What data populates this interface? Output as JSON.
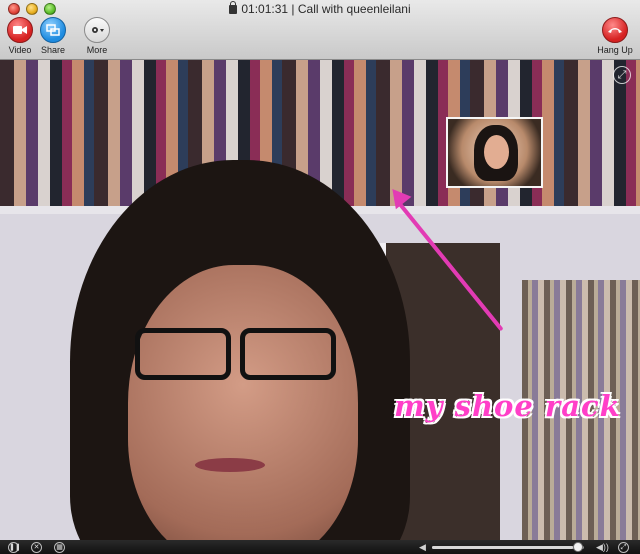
{
  "window": {
    "title": "01:01:31 | Call with queenleilani"
  },
  "toolbar": {
    "video_label": "Video",
    "share_label": "Share",
    "more_label": "More",
    "hangup_label": "Hang Up"
  },
  "icons": {
    "video": "video-camera-icon",
    "share": "screen-share-icon",
    "more": "gear-icon",
    "hangup": "phone-hangup-icon",
    "fullscreen": "expand-icon",
    "lock": "lock-icon"
  },
  "annotation": {
    "text": "my shoe rack",
    "color": "#ff3fc8"
  },
  "controls": {
    "volume_level": 0.93
  },
  "colors": {
    "hangup_red": "#d62222",
    "share_blue": "#1f8ce0",
    "arrow_pink": "#e23bb4"
  }
}
